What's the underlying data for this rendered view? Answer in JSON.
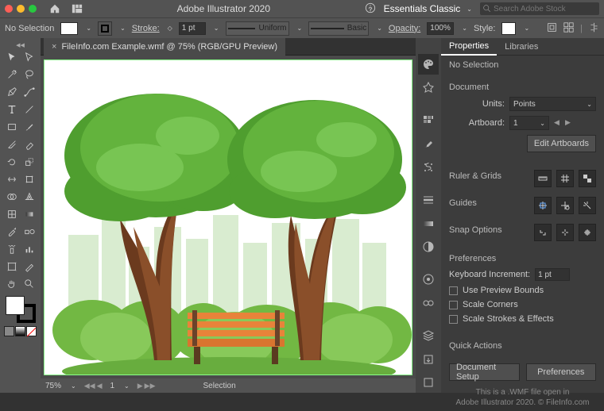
{
  "topbar": {
    "app_title": "Adobe Illustrator 2020",
    "workspace": "Essentials Classic",
    "search_placeholder": "Search Adobe Stock"
  },
  "controlbar": {
    "selection_text": "No Selection",
    "stroke_label": "Stroke:",
    "stroke_value": "1 pt",
    "brush_uniform": "Uniform",
    "brush_basic": "Basic",
    "opacity_label": "Opacity:",
    "opacity_value": "100%",
    "style_label": "Style:"
  },
  "tab": {
    "filename": "FileInfo.com Example.wmf @ 75% (RGB/GPU Preview)"
  },
  "statusbar": {
    "zoom": "75%",
    "artboard_nav": "1",
    "tool": "Selection"
  },
  "properties": {
    "tab_properties": "Properties",
    "tab_libraries": "Libraries",
    "no_selection": "No Selection",
    "document_hdr": "Document",
    "units_label": "Units:",
    "units_value": "Points",
    "artboard_label": "Artboard:",
    "artboard_value": "1",
    "edit_artboards": "Edit Artboards",
    "ruler_grids": "Ruler & Grids",
    "guides": "Guides",
    "snap_options": "Snap Options",
    "preferences_hdr": "Preferences",
    "key_inc_label": "Keyboard Increment:",
    "key_inc_value": "1 pt",
    "use_preview": "Use Preview Bounds",
    "scale_corners": "Scale Corners",
    "scale_strokes": "Scale Strokes & Effects",
    "quick_actions": "Quick Actions",
    "doc_setup": "Document Setup",
    "preferences_btn": "Preferences"
  },
  "footer": {
    "line1": "This is a .WMF file open in",
    "line2": "Adobe Illustrator 2020. © FileInfo.com"
  }
}
